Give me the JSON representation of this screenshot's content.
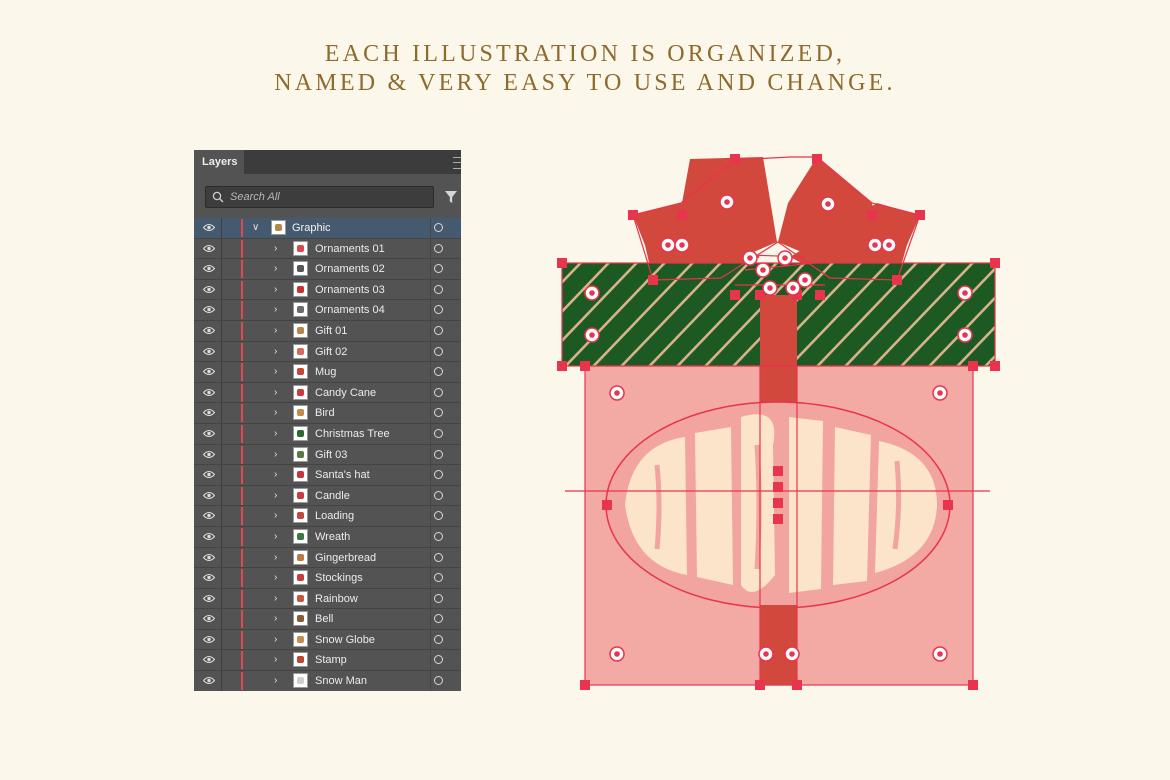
{
  "headline": {
    "line1": "EACH ILLUSTRATION IS ORGANIZED,",
    "line2": "NAMED & VERY EASY TO USE AND CHANGE."
  },
  "panel": {
    "tab_label": "Layers",
    "search_placeholder": "Search All",
    "menu_icon": "hamburger-icon",
    "filter_icon": "filter-icon",
    "top_layer": {
      "name": "Graphic",
      "expanded": true
    },
    "sublayers": [
      {
        "name": "Ornaments 01",
        "thumb": "#d9484c"
      },
      {
        "name": "Ornaments 02",
        "thumb": "#555555"
      },
      {
        "name": "Ornaments 03",
        "thumb": "#c9302f"
      },
      {
        "name": "Ornaments 04",
        "thumb": "#6b6b6b"
      },
      {
        "name": "Gift 01",
        "thumb": "#b9864a"
      },
      {
        "name": "Gift 02",
        "thumb": "#d96a5a"
      },
      {
        "name": "Mug",
        "thumb": "#c84538"
      },
      {
        "name": "Candy Cane",
        "thumb": "#cf3b3b"
      },
      {
        "name": "Bird",
        "thumb": "#c48b4c"
      },
      {
        "name": "Christmas Tree",
        "thumb": "#2e6b32"
      },
      {
        "name": "Gift 03",
        "thumb": "#5b7a40"
      },
      {
        "name": "Santa's hat",
        "thumb": "#c7333a"
      },
      {
        "name": "Candle",
        "thumb": "#cc3c3c"
      },
      {
        "name": "Loading",
        "thumb": "#c34845"
      },
      {
        "name": "Wreath",
        "thumb": "#3a7a3f"
      },
      {
        "name": "Gingerbread",
        "thumb": "#b87a45"
      },
      {
        "name": "Stockings",
        "thumb": "#c83c3c"
      },
      {
        "name": "Rainbow",
        "thumb": "#c65640"
      },
      {
        "name": "Bell",
        "thumb": "#8a5a33"
      },
      {
        "name": "Snow Globe",
        "thumb": "#c88a52"
      },
      {
        "name": "Stamp",
        "thumb": "#c2452c"
      },
      {
        "name": "Snow Man",
        "thumb": "#cfcfcf"
      }
    ]
  },
  "artwork": {
    "lid_color": "#1d5a23",
    "stripe_color": "#d7b28b",
    "ribbon_color": "#d2483c",
    "box_color": "#f2a4a0",
    "selection_color": "#e8344d",
    "label_fill": "#fbe4c9"
  }
}
